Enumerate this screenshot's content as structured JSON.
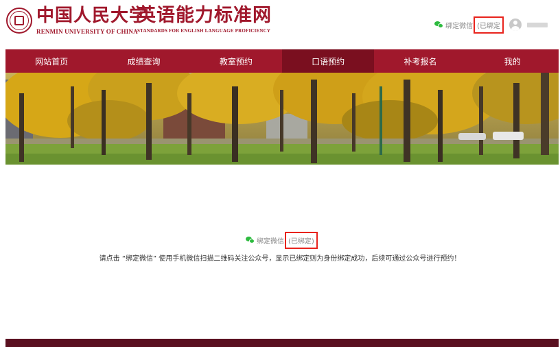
{
  "header": {
    "university_cn": "中国人民大学",
    "university_en": "RENMIN UNIVERSITY OF CHINA",
    "site_title_cn": "英语能力标准网",
    "site_title_en": "STANDARDS FOR ENGLISH LANGUAGE PROFICIENCY",
    "wechat_label": "绑定微信",
    "bound_status": "(已绑定"
  },
  "nav": {
    "items": [
      {
        "label": "网站首页"
      },
      {
        "label": "成绩查询"
      },
      {
        "label": "教室预约"
      },
      {
        "label": "口语预约"
      },
      {
        "label": "补考报名"
      },
      {
        "label": "我的"
      }
    ],
    "active_index": 3
  },
  "main": {
    "wechat_label": "绑定微信",
    "bound_status": "(已绑定)",
    "instruction": "请点击 “绑定微信” 使用手机微信扫描二维码关注公众号，显示已绑定则为身份绑定成功，后续可通过公众号进行预约！"
  },
  "colors": {
    "brand_red": "#a0182c",
    "nav_active": "#7a0f1f",
    "wechat_green": "#2dbb3f",
    "highlight_box": "#e8231c",
    "footer": "#5a1020"
  },
  "icons": {
    "logo": "university-seal-icon",
    "wechat": "wechat-icon",
    "avatar": "user-avatar-icon"
  }
}
